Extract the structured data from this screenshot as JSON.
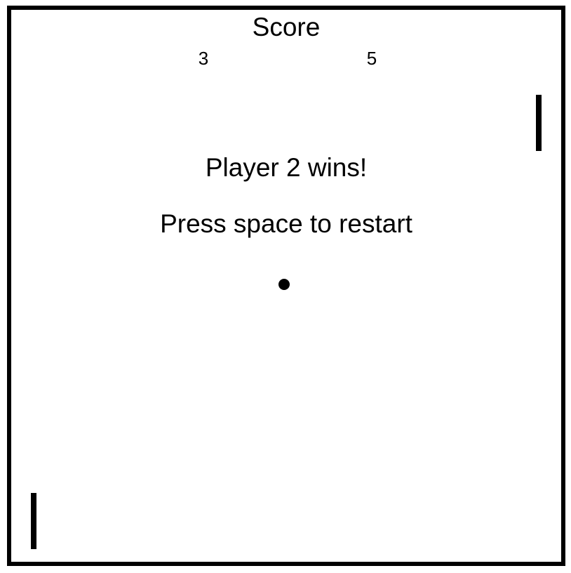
{
  "scoreboard": {
    "title": "Score",
    "player1_score": "3",
    "player2_score": "5"
  },
  "messages": {
    "winner": "Player 2 wins!",
    "restart": "Press space to restart"
  },
  "colors": {
    "foreground": "#000000",
    "background": "#ffffff"
  }
}
